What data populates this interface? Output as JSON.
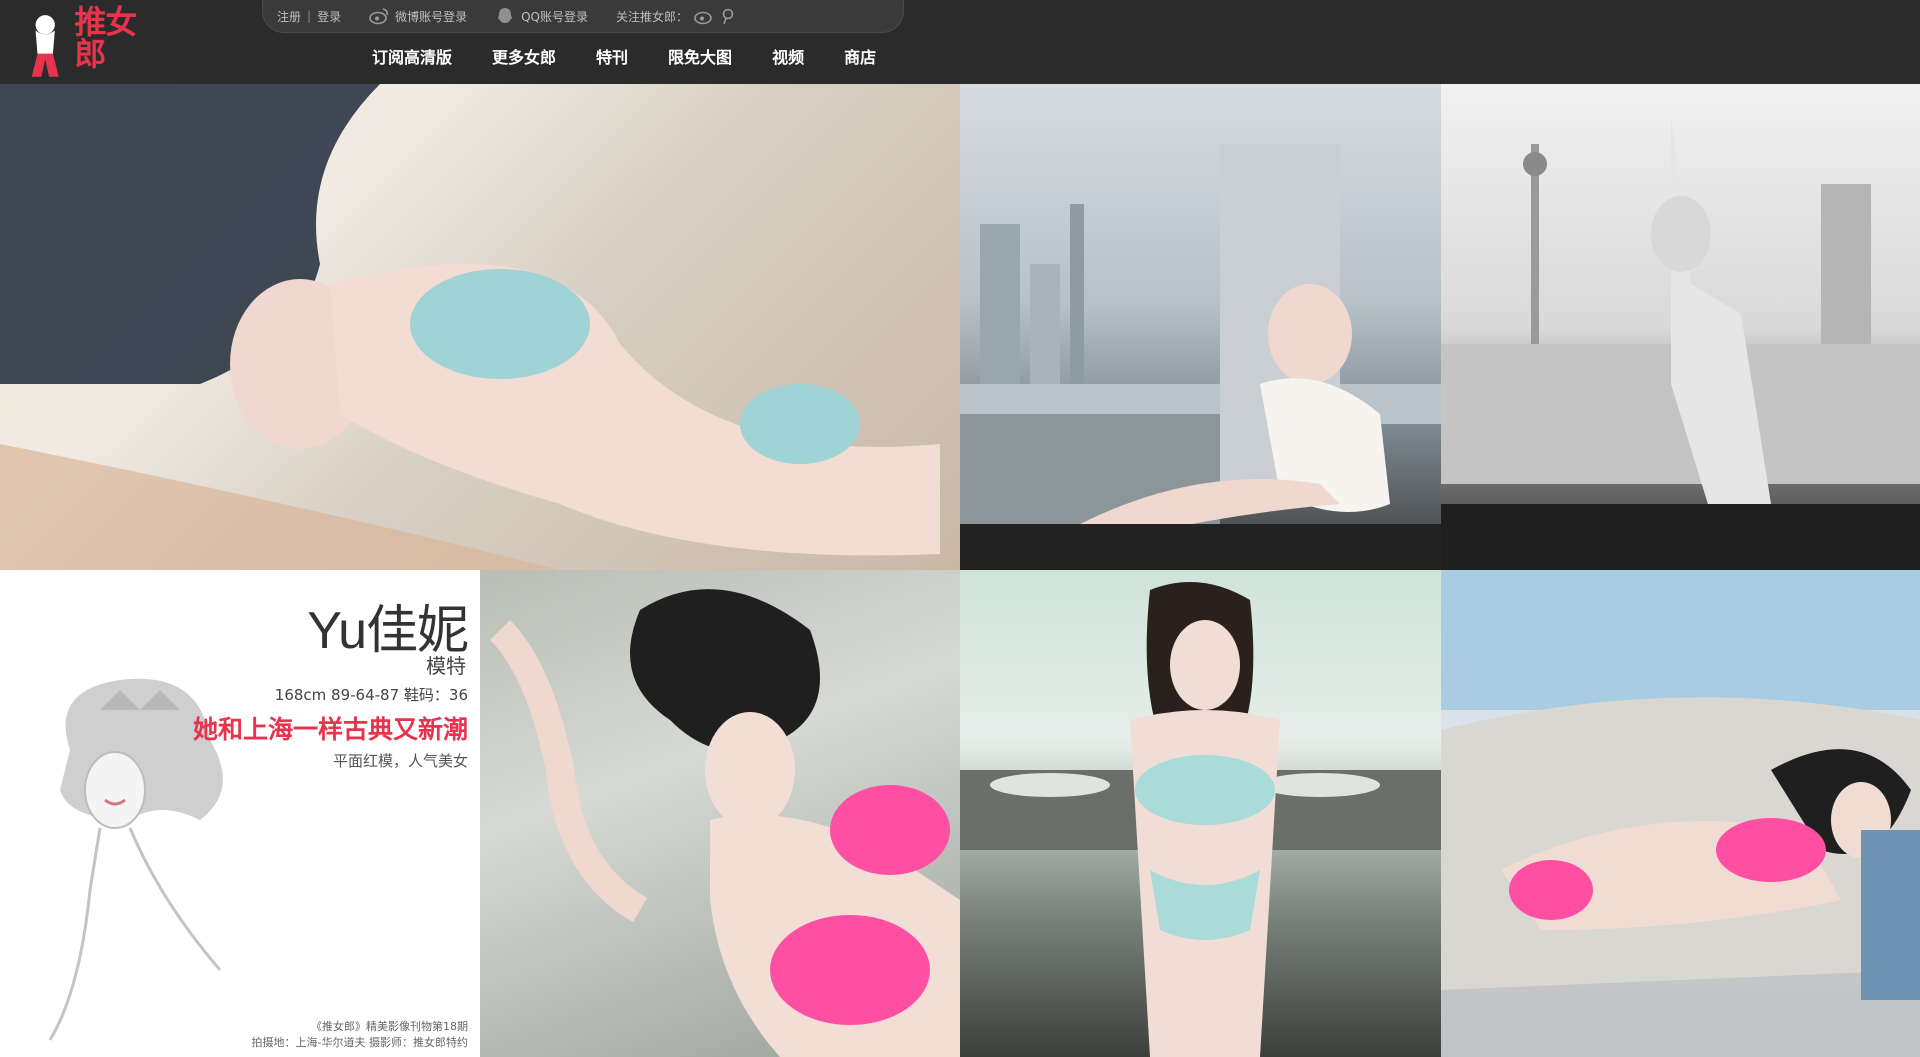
{
  "header": {
    "logo_text": "推女郎",
    "topbar": {
      "register": "注册",
      "separator": "|",
      "login": "登录",
      "weibo_login": "微博账号登录",
      "qq_login": "QQ账号登录",
      "follow": "关注推女郎："
    },
    "nav": [
      "订阅高清版",
      "更多女郎",
      "特刊",
      "限免大图",
      "视频",
      "商店"
    ]
  },
  "model": {
    "name": "Yu佳妮",
    "role": "模特",
    "stats": "168cm 89-64-87 鞋码：36",
    "tagline": "她和上海一样古典又新潮",
    "desc": "平面红模，人气美女",
    "credit_line1": "《推女郎》精美影像刊物第18期",
    "credit_line2": "拍摄地：上海-华尔道夫 摄影师：推女郎特约"
  },
  "colors": {
    "header_bg": "#2b2b2b",
    "accent": "#e8334e"
  },
  "icons": [
    "weibo-icon",
    "qq-icon",
    "weibo-follow-icon",
    "tencent-weibo-icon"
  ]
}
